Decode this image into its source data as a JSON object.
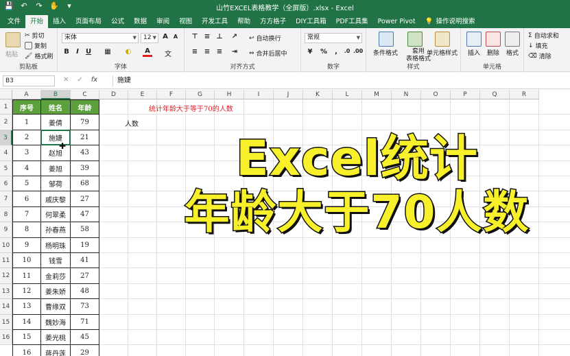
{
  "window": {
    "title": "山竹EXCEL表格教学（全屏版）.xlsx - Excel",
    "qat": [
      "save",
      "undo",
      "redo",
      "touch-mode",
      "customize"
    ]
  },
  "tabs": [
    "文件",
    "开始",
    "插入",
    "页面布局",
    "公式",
    "数据",
    "审阅",
    "视图",
    "开发工具",
    "帮助",
    "方方格子",
    "DIY工具箱",
    "PDF工具集",
    "Power Pivot"
  ],
  "tell_me": "操作说明搜索",
  "ribbon": {
    "clipboard": {
      "label": "剪贴板",
      "paste": "粘贴",
      "cut": "剪切",
      "copy": "复制",
      "format_painter": "格式刷"
    },
    "font": {
      "label": "字体",
      "name": "宋体",
      "size": "12"
    },
    "alignment": {
      "label": "对齐方式",
      "wrap": "自动换行",
      "merge": "合并后居中"
    },
    "number": {
      "label": "数字",
      "format": "常规"
    },
    "styles": {
      "label": "样式",
      "cond": "条件格式",
      "table": "套用\n表格格式",
      "cell": "单元格样式"
    },
    "cells": {
      "label": "单元格",
      "insert": "插入",
      "delete": "删除",
      "format": "格式"
    },
    "editing": {
      "autosum": "自动求和",
      "fill": "填充",
      "clear": "清除"
    }
  },
  "formula_bar": {
    "name_box": "B3",
    "content": "施婕"
  },
  "columns": [
    "A",
    "B",
    "C",
    "D",
    "E",
    "F",
    "G",
    "H",
    "I",
    "J",
    "K",
    "L",
    "M",
    "N",
    "O",
    "P",
    "Q",
    "R"
  ],
  "rows": [
    "1",
    "2",
    "3",
    "4",
    "5",
    "6",
    "7",
    "8",
    "9",
    "10",
    "11",
    "12",
    "13",
    "14",
    "15",
    "16"
  ],
  "table": {
    "headers": [
      "序号",
      "姓名",
      "年龄"
    ],
    "rows": [
      [
        "1",
        "姜倩",
        "79"
      ],
      [
        "2",
        "施婕",
        "21"
      ],
      [
        "3",
        "赵旭",
        "43"
      ],
      [
        "4",
        "姜旭",
        "39"
      ],
      [
        "5",
        "邹荷",
        "68"
      ],
      [
        "6",
        "戚庆黎",
        "27"
      ],
      [
        "7",
        "何翠柔",
        "47"
      ],
      [
        "8",
        "孙春燕",
        "58"
      ],
      [
        "9",
        "杨明珠",
        "19"
      ],
      [
        "10",
        "钱雪",
        "41"
      ],
      [
        "11",
        "金莉莎",
        "27"
      ],
      [
        "12",
        "姜朱娇",
        "48"
      ],
      [
        "13",
        "曹缘双",
        "73"
      ],
      [
        "14",
        "魏妙海",
        "71"
      ],
      [
        "15",
        "姜光桃",
        "45"
      ],
      [
        "16",
        "蒋丹莲",
        "29"
      ]
    ]
  },
  "note": "统计年龄大于等于70的人数",
  "count_label": "人数",
  "overlay": {
    "line1": "Excel统计",
    "line2": "年龄大于70人数"
  },
  "colors": {
    "excel_green": "#217346",
    "header_green": "#5da13c",
    "note_red": "#d9222a",
    "overlay_yellow": "#f7f02a"
  }
}
